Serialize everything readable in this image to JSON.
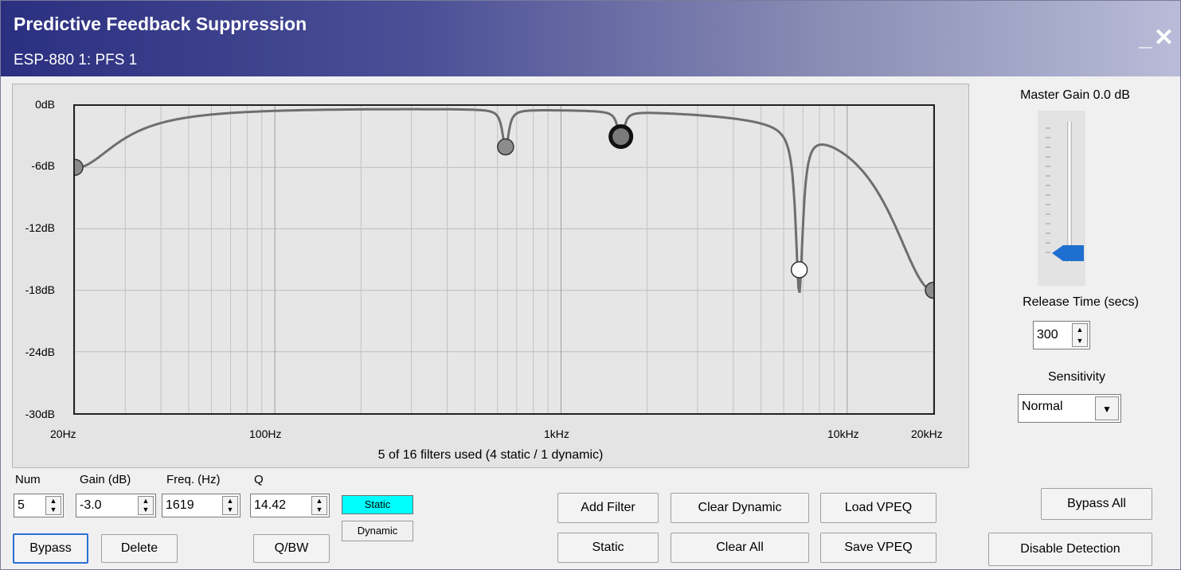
{
  "window": {
    "title": "Predictive Feedback Suppression",
    "subtitle": "ESP-880 1: PFS 1",
    "minimize_glyph": "_",
    "close_glyph": "✕"
  },
  "graph": {
    "y_labels": [
      "0dB",
      "-6dB",
      "-12dB",
      "-18dB",
      "-24dB",
      "-30dB"
    ],
    "x_labels": [
      "20Hz",
      "100Hz",
      "1kHz",
      "10kHz",
      "20kHz"
    ],
    "usage_text": "5 of 16 filters used (4 static / 1 dynamic)"
  },
  "chart_data": {
    "type": "line",
    "xscale": "log",
    "xlim": [
      20,
      20000
    ],
    "ylim": [
      -30,
      0
    ],
    "filters": [
      {
        "freq": 20,
        "gain": -6,
        "q": 1.0,
        "style": "static"
      },
      {
        "freq": 640,
        "gain": -4,
        "q": 14.4,
        "style": "static"
      },
      {
        "freq": 1619,
        "gain": -3,
        "q": 14.42,
        "style": "selected"
      },
      {
        "freq": 6800,
        "gain": -16,
        "q": 12,
        "style": "dynamic"
      },
      {
        "freq": 20000,
        "gain": -18,
        "q": 1.0,
        "style": "static"
      }
    ]
  },
  "controls": {
    "labels": {
      "num": "Num",
      "gain": "Gain (dB)",
      "freq": "Freq. (Hz)",
      "q": "Q"
    },
    "num_value": "5",
    "gain_value": "-3.0",
    "freq_value": "1619",
    "q_value": "14.42",
    "static_chip": "Static",
    "dynamic_chip": "Dynamic",
    "bypass": "Bypass",
    "delete": "Delete",
    "qbw": "Q/BW",
    "add_filter": "Add Filter",
    "static_button": "Static",
    "clear_dynamic": "Clear Dynamic",
    "clear_all": "Clear All",
    "load_vpeq": "Load VPEQ",
    "save_vpeq": "Save VPEQ",
    "bypass_all": "Bypass All",
    "disable_detection": "Disable Detection"
  },
  "right_panel": {
    "master_gain_label": "Master Gain 0.0 dB",
    "master_gain_level": 0.0,
    "release_label": "Release Time (secs)",
    "release_value": "300",
    "sensitivity_label": "Sensitivity",
    "sensitivity_value": "Normal"
  },
  "colors": {
    "curve": "#6e6e6e",
    "static_chip": "#00ffff",
    "title_start": "#2b2f80",
    "slider_thumb": "#1f6fd0"
  }
}
